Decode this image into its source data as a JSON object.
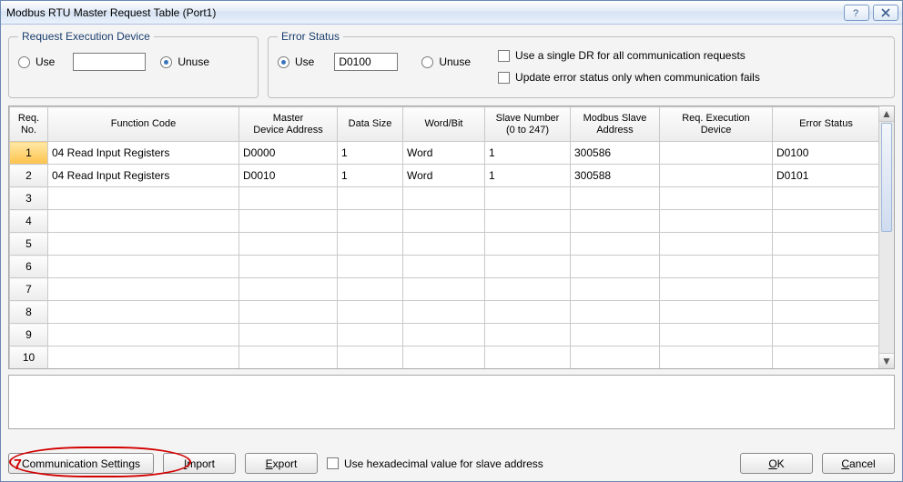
{
  "title": "Modbus RTU Master Request Table (Port1)",
  "groups": {
    "request_exec": {
      "legend": "Request Execution Device",
      "use_label": "Use",
      "unuse_label": "Unuse",
      "selected": "unuse",
      "value": ""
    },
    "error_status": {
      "legend": "Error Status",
      "use_label": "Use",
      "unuse_label": "Unuse",
      "selected": "use",
      "value": "D0100",
      "single_dr_label": "Use a single DR for all communication requests",
      "update_fail_label": "Update error status only when communication fails"
    }
  },
  "table": {
    "headers": {
      "req_no": "Req.\nNo.",
      "func": "Function Code",
      "master_addr": "Master\nDevice Address",
      "size": "Data Size",
      "wordbit": "Word/Bit",
      "slave_no": "Slave Number\n(0 to 247)",
      "slave_addr": "Modbus Slave\nAddress",
      "exec_dev": "Req. Execution\nDevice",
      "err": "Error Status"
    },
    "rows": [
      {
        "n": "1",
        "func": "04 Read Input Registers",
        "maddr": "D0000",
        "size": "1",
        "wb": "Word",
        "sn": "1",
        "sa": "300586",
        "ed": "",
        "err": "D0100"
      },
      {
        "n": "2",
        "func": "04 Read Input Registers",
        "maddr": "D0010",
        "size": "1",
        "wb": "Word",
        "sn": "1",
        "sa": "300588",
        "ed": "",
        "err": "D0101"
      },
      {
        "n": "3"
      },
      {
        "n": "4"
      },
      {
        "n": "5"
      },
      {
        "n": "6"
      },
      {
        "n": "7"
      },
      {
        "n": "8"
      },
      {
        "n": "9"
      },
      {
        "n": "10"
      }
    ]
  },
  "bottom": {
    "comm_settings": "Communication Settings",
    "import": "Import",
    "export": "Export",
    "hex_label": "Use hexadecimal value for slave address",
    "ok": "OK",
    "cancel": "Cancel"
  },
  "callout": {
    "num": "7"
  }
}
